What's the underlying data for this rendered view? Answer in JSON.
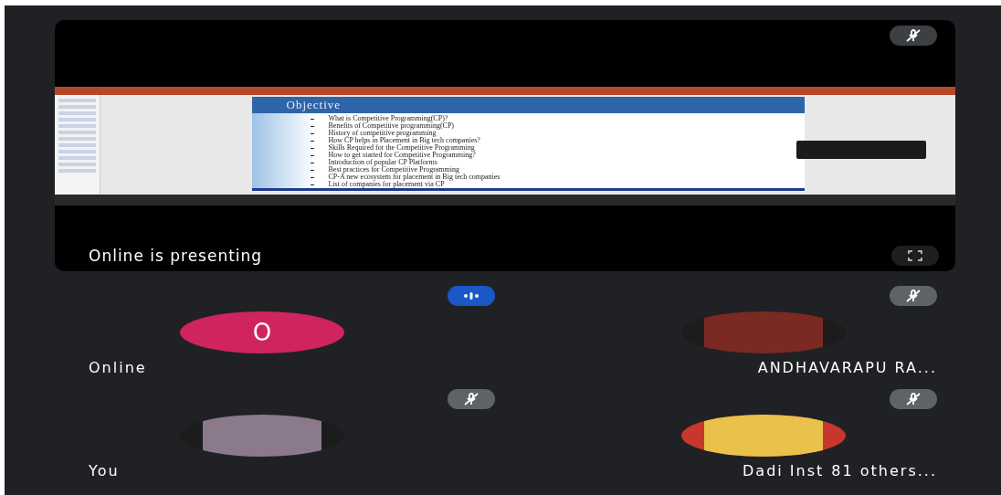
{
  "presentation": {
    "caption": "Online is presenting",
    "muted": true,
    "slide": {
      "title": "Objective",
      "bullets": [
        "What is Competitive Programming(CP)?",
        "Benefits of Competitive programming(CP)",
        "History of competitive programming",
        "How CP helps in Placement in Big tech companies?",
        "Skills Required for the Competitive Programming",
        "How to get started for Competitive Programming?",
        "Introduction of popular CP Platforms",
        "Best practices for Competitive Programming",
        "CP-A new ecosystem for placement in Big tech companies",
        "List of companies for placement via CP"
      ]
    }
  },
  "participants": [
    {
      "name": "Online",
      "avatar": {
        "kind": "letter",
        "letter": "O",
        "color": "#d0245e"
      },
      "muted": false,
      "speaking": true
    },
    {
      "name": "ANDHAVARAPU RA...",
      "avatar": {
        "kind": "photo"
      },
      "muted": true,
      "speaking": false
    },
    {
      "name": "You",
      "avatar": {
        "kind": "photo"
      },
      "muted": true,
      "speaking": false
    },
    {
      "name": "Dadi Inst",
      "extra": "81 others...",
      "avatar": {
        "kind": "logo"
      },
      "muted": true,
      "speaking": false
    }
  ]
}
